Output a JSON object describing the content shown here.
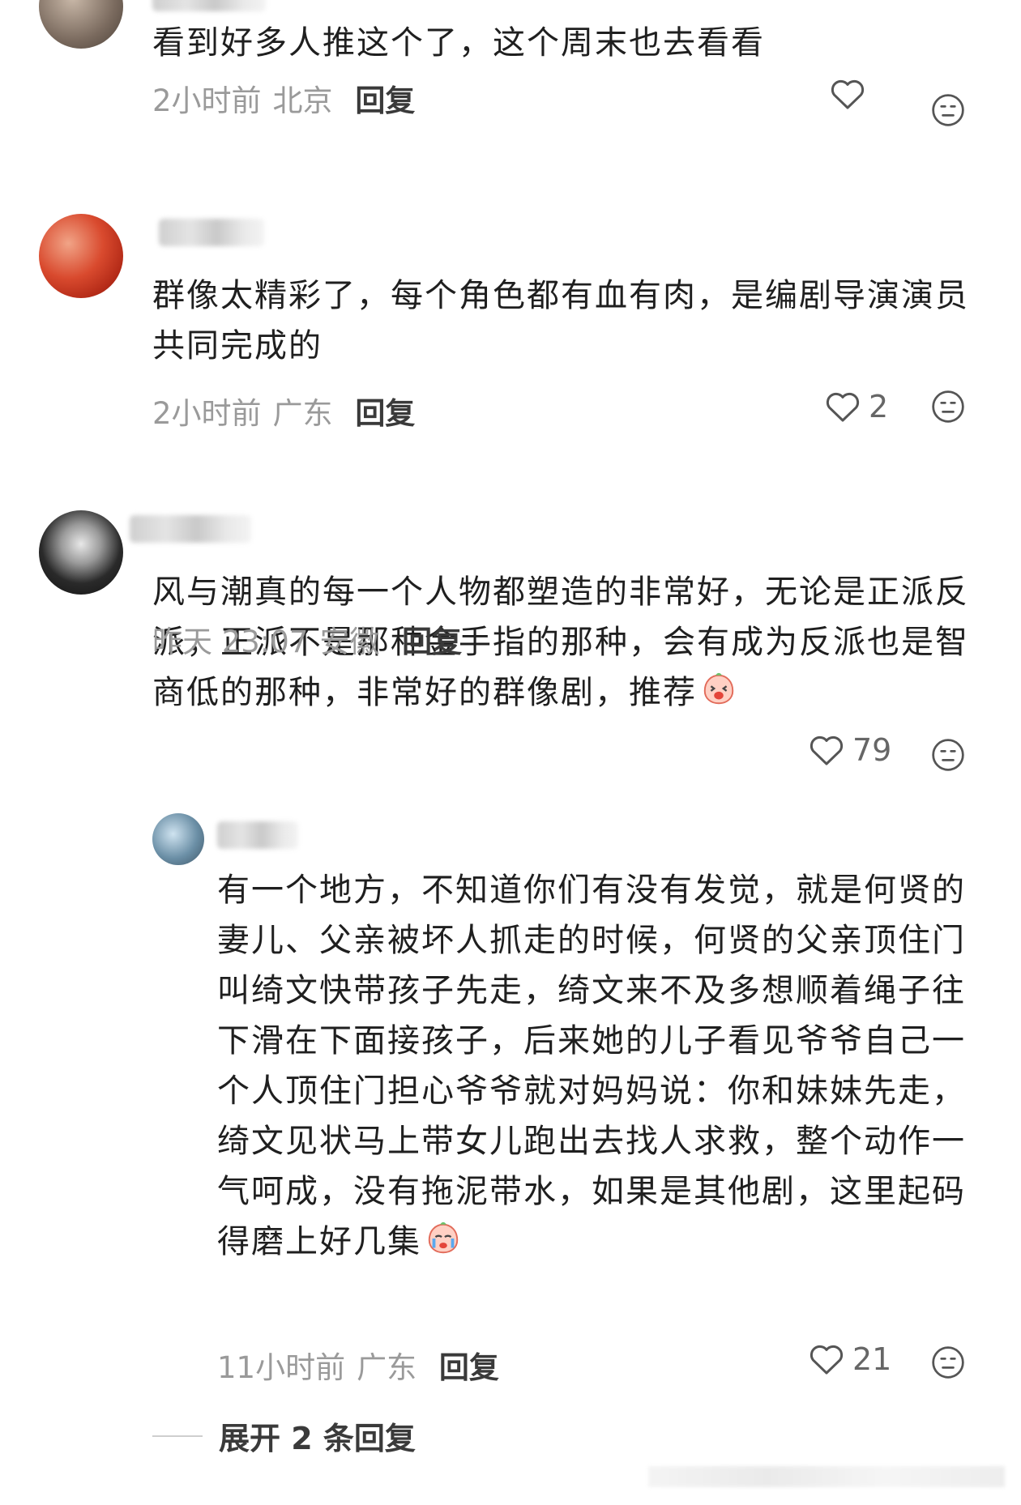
{
  "comments": [
    {
      "text": "看到好多人推这个了，这个周末也去看看",
      "time": "2小时前",
      "location": "北京",
      "reply_label": "回复",
      "likes": ""
    },
    {
      "text": "群像太精彩了，每个角色都有血有肉，是编剧导演演员共同完成的",
      "time": "2小时前",
      "location": "广东",
      "reply_label": "回复",
      "likes": "2"
    },
    {
      "text": "风与潮真的每一个人物都塑造的非常好，无论是正派反派，正派不是那种金手指的那种，会有成为反派也是智商低的那种，非常好的群像剧，推荐",
      "time": "昨天 23:07",
      "location": "安徽",
      "reply_label": "回复",
      "likes": "79",
      "trailing_emoji": "laughing-sticker"
    }
  ],
  "reply": {
    "text": "有一个地方，不知道你们有没有发觉，就是何贤的妻儿、父亲被坏人抓走的时候，何贤的父亲顶住门叫绮文快带孩子先走，绮文来不及多想顺着绳子往下滑在下面接孩子，后来她的儿子看见爷爷自己一个人顶住门担心爷爷就对妈妈说：你和妹妹先走，绮文见状马上带女儿跑出去找人求救，整个动作一气呵成，没有拖泥带水，如果是其他剧，这里起码得磨上好几集",
    "time": "11小时前",
    "location": "广东",
    "reply_label": "回复",
    "likes": "21",
    "trailing_emoji": "crying-sticker"
  },
  "expand_label": "展开 2 条回复",
  "colors": {
    "meta": "#9a9a9a",
    "text": "#1f1f1f",
    "icon": "#555555"
  }
}
